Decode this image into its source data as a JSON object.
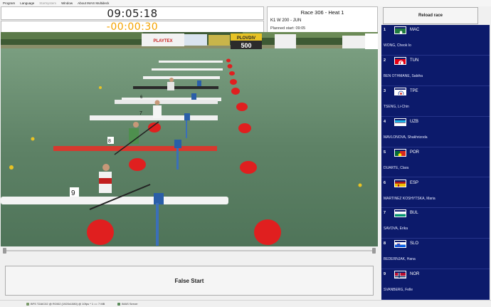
{
  "menu": {
    "items": [
      {
        "label": "Program",
        "enabled": true
      },
      {
        "label": "Language",
        "enabled": true
      },
      {
        "label": "Startsystem",
        "enabled": false
      },
      {
        "label": "Window",
        "enabled": true
      },
      {
        "label": "About IMAS Multideck",
        "enabled": true
      }
    ]
  },
  "clock": {
    "time": "09:05:18"
  },
  "countdown": {
    "value": "-00:00:30",
    "color": "#f5a300"
  },
  "race": {
    "title": "Race 306  -  Heat 1",
    "class": "K1 W 200 - JUN",
    "planned_start": "Planned start:  09:05"
  },
  "video": {
    "banners": [
      "PLAYTEX",
      "PLOVDIV",
      "500"
    ],
    "lane_numbers": [
      "9",
      "8",
      "7",
      "6"
    ]
  },
  "controls": {
    "false_start_label": "False Start",
    "reload_label": "Reload race"
  },
  "lanes": [
    {
      "num": "1",
      "code": "MAC",
      "athlete": "WONG, Cheok Io",
      "flag": "MAC"
    },
    {
      "num": "2",
      "code": "TUN",
      "athlete": "BEN OTHMANE, Sabiha",
      "flag": "TUN"
    },
    {
      "num": "3",
      "code": "TPE",
      "athlete": "TSENG, Li-Chin",
      "flag": "TPE"
    },
    {
      "num": "4",
      "code": "UZB",
      "athlete": "MAVLONOVA, Shakhrizoda",
      "flag": "UZB"
    },
    {
      "num": "5",
      "code": "POR",
      "athlete": "DUARTE, Clara",
      "flag": "POR"
    },
    {
      "num": "6",
      "code": "ESP",
      "athlete": "MARTINEZ KOSHYTSKA, Maria",
      "flag": "ESP"
    },
    {
      "num": "7",
      "code": "BUL",
      "athlete": "SAVOVA, Erika",
      "flag": "BUL"
    },
    {
      "num": "8",
      "code": "SLO",
      "athlete": "BEDERNJAK, Hana",
      "flag": "SLO"
    },
    {
      "num": "9",
      "code": "NOR",
      "athlete": "SVANBERG, Felle",
      "flag": "NOR"
    }
  ],
  "statusbar": {
    "camera": "BFS T2AIC02 @ ROI02 (1920x1080) @ 10fps * 1 == 7 MB",
    "server": "IMAS Server"
  }
}
